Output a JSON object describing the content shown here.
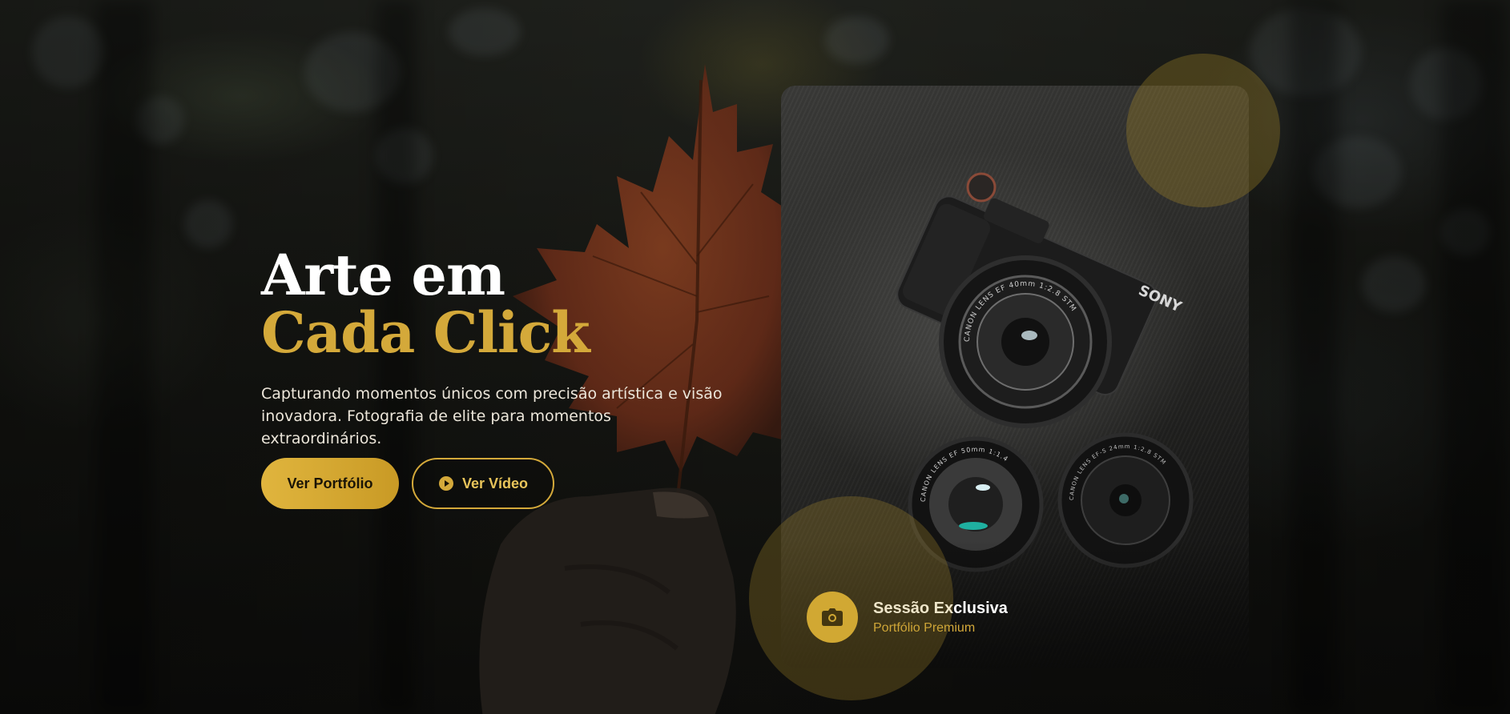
{
  "hero": {
    "title_line1": "Arte em",
    "title_line2": "Cada Click",
    "subtitle": "Capturando momentos únicos com precisão artística e visão inovadora. Fotografia de elite para momentos extraordinários.",
    "primary_button": "Ver Portfólio",
    "secondary_button": "Ver Vídeo"
  },
  "card": {
    "title": "Sessão Exclusiva",
    "subtitle": "Portfólio Premium",
    "camera_brand": "SONY",
    "lens_main": "CANON LENS EF 40mm 1:2.8 STM",
    "lens_left": "CANON LENS EF 50mm 1:1.4",
    "lens_right": "CANON LENS EF-S 24mm 1:2.8 STM"
  },
  "icons": {
    "play": "play-circle-icon",
    "camera": "camera-icon"
  },
  "colors": {
    "accent": "#d4a93a",
    "accent_light": "#e0b53e",
    "text_light": "#ece6da",
    "background": "#0d0c0a"
  }
}
